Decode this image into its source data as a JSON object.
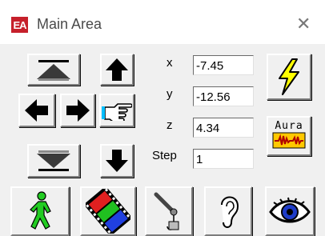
{
  "window": {
    "title": "Main Area",
    "app_icon_text": "EA",
    "close_icon": "close-icon"
  },
  "fields": {
    "x": {
      "label": "x",
      "value": "-7.45"
    },
    "y": {
      "label": "y",
      "value": "-12.56"
    },
    "z": {
      "label": "z",
      "value": "4.34"
    },
    "step": {
      "label": "Step",
      "value": "1"
    }
  },
  "buttons": {
    "aura": {
      "label": "Aura"
    },
    "icons": [
      "page-up-icon",
      "arrow-up-icon",
      "arrow-left-icon",
      "arrow-right-icon",
      "pointing-hand-icon",
      "arrow-down-fill-icon",
      "arrow-down-icon",
      "lightning-icon",
      "aura-waveform-icon",
      "walking-man-icon",
      "film-strip-icon",
      "microphone-icon",
      "ear-icon",
      "eye-icon"
    ]
  },
  "colors": {
    "face": "#f0f0f0",
    "titlebar_icon": "#c6202b",
    "lightning": "#ffff00",
    "walker": "#22cc22",
    "eye_iris": "#1e3cc8"
  }
}
